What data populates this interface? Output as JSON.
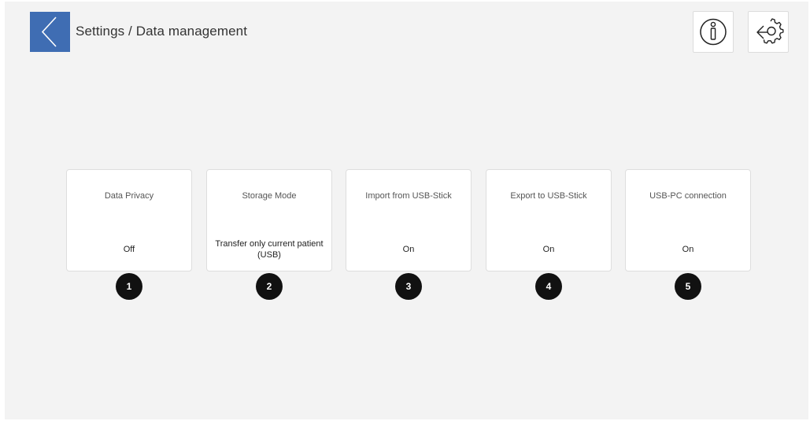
{
  "header": {
    "title": "Settings / Data management",
    "back_icon": "chevron-left-icon",
    "info_icon": "info-icon",
    "config_icon": "gear-arrows-icon",
    "accent_color": "#3f6db3"
  },
  "tiles": [
    {
      "label": "Data Privacy",
      "value": "Off",
      "marker": "1"
    },
    {
      "label": "Storage Mode",
      "value": "Transfer only current patient (USB)",
      "marker": "2"
    },
    {
      "label": "Import from USB-Stick",
      "value": "On",
      "marker": "3"
    },
    {
      "label": "Export to USB-Stick",
      "value": "On",
      "marker": "4"
    },
    {
      "label": "USB-PC connection",
      "value": "On",
      "marker": "5"
    }
  ]
}
